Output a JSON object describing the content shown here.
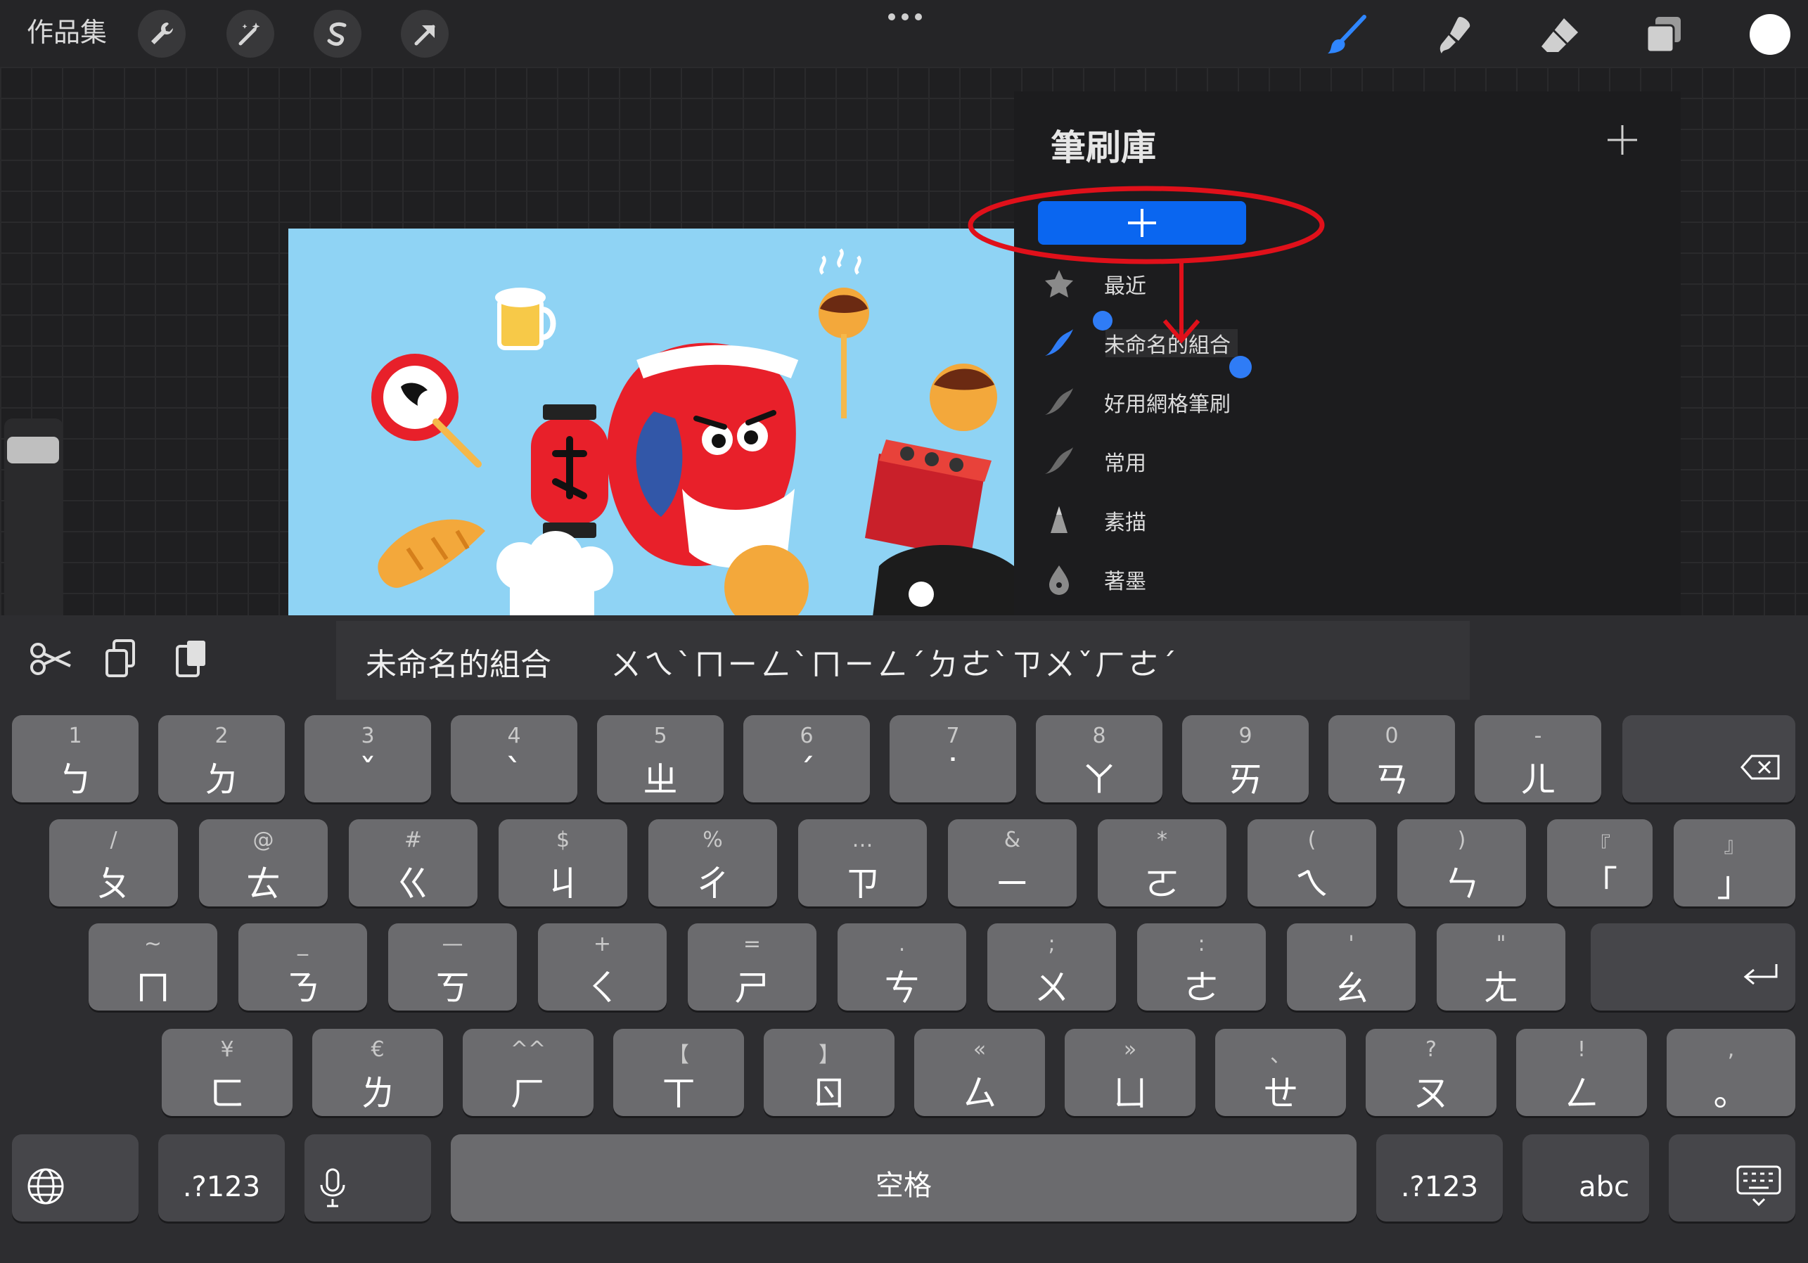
{
  "toolbar": {
    "gallery": "作品集",
    "tools": [
      "wrench-icon",
      "magic-wand-icon",
      "selection-icon",
      "transform-arrow-icon"
    ],
    "right_tools": [
      "brush-icon",
      "smudge-icon",
      "eraser-icon",
      "layers-icon"
    ],
    "active_tool": "brush",
    "current_color": "#ffffff"
  },
  "brush_library": {
    "title": "筆刷庫",
    "items": [
      {
        "label": "最近",
        "icon": "star-icon"
      },
      {
        "label": "未命名的組合",
        "icon": "brush-stroke-icon",
        "selected": true,
        "editing": true
      },
      {
        "label": "好用網格筆刷",
        "icon": "brush-stroke-icon"
      },
      {
        "label": "常用",
        "icon": "brush-stroke-icon"
      },
      {
        "label": "素描",
        "icon": "pencil-tip-icon"
      },
      {
        "label": "著墨",
        "icon": "ink-drop-icon"
      }
    ]
  },
  "keyboard": {
    "candidate_word": "未命名的組合",
    "candidate_zhuyin": "ㄨㄟˋㄇㄧㄥˋㄇㄧㄥˊㄉㄜˋㄗㄨˇㄏㄜˊ",
    "rows": [
      [
        {
          "s": "1",
          "p": "ㄅ"
        },
        {
          "s": "2",
          "p": "ㄉ"
        },
        {
          "s": "3",
          "p": "ˇ"
        },
        {
          "s": "4",
          "p": "ˋ"
        },
        {
          "s": "5",
          "p": "ㄓ"
        },
        {
          "s": "6",
          "p": "ˊ"
        },
        {
          "s": "7",
          "p": "˙"
        },
        {
          "s": "8",
          "p": "ㄚ"
        },
        {
          "s": "9",
          "p": "ㄞ"
        },
        {
          "s": "0",
          "p": "ㄢ"
        },
        {
          "s": "-",
          "p": "ㄦ"
        }
      ],
      [
        {
          "s": "/",
          "p": "ㄆ"
        },
        {
          "s": "@",
          "p": "ㄊ"
        },
        {
          "s": "#",
          "p": "ㄍ"
        },
        {
          "s": "$",
          "p": "ㄐ"
        },
        {
          "s": "%",
          "p": "ㄔ"
        },
        {
          "s": "…",
          "p": "ㄗ"
        },
        {
          "s": "&",
          "p": "ㄧ"
        },
        {
          "s": "*",
          "p": "ㄛ"
        },
        {
          "s": "(",
          "p": "ㄟ"
        },
        {
          "s": ")",
          "p": "ㄣ"
        },
        {
          "s": "『",
          "p": "「"
        },
        {
          "s": "』",
          "p": "」"
        }
      ],
      [
        {
          "s": "~",
          "p": "ㄇ"
        },
        {
          "s": "_",
          "p": "ㄋ"
        },
        {
          "s": "—",
          "p": "ㄎ"
        },
        {
          "s": "+",
          "p": "ㄑ"
        },
        {
          "s": "=",
          "p": "ㄕ"
        },
        {
          "s": ".",
          "p": "ㄘ"
        },
        {
          "s": ";",
          "p": "ㄨ"
        },
        {
          "s": ":",
          "p": "ㄜ"
        },
        {
          "s": "'",
          "p": "ㄠ"
        },
        {
          "s": "\"",
          "p": "ㄤ"
        }
      ],
      [
        {
          "s": "¥",
          "p": "ㄈ"
        },
        {
          "s": "€",
          "p": "ㄌ"
        },
        {
          "s": "^^",
          "p": "ㄏ"
        },
        {
          "s": "【",
          "p": "ㄒ"
        },
        {
          "s": "】",
          "p": "ㄖ"
        },
        {
          "s": "«",
          "p": "ㄙ"
        },
        {
          "s": "»",
          "p": "ㄩ"
        },
        {
          "s": "、",
          "p": "ㄝ"
        },
        {
          "s": "?",
          "p": "ㄡ"
        },
        {
          "s": "!",
          "p": "ㄥ"
        },
        {
          "s": ",",
          "p": "。"
        }
      ]
    ],
    "numbers_key": ".?123",
    "space_key": "空格",
    "abc_key": "abc"
  }
}
